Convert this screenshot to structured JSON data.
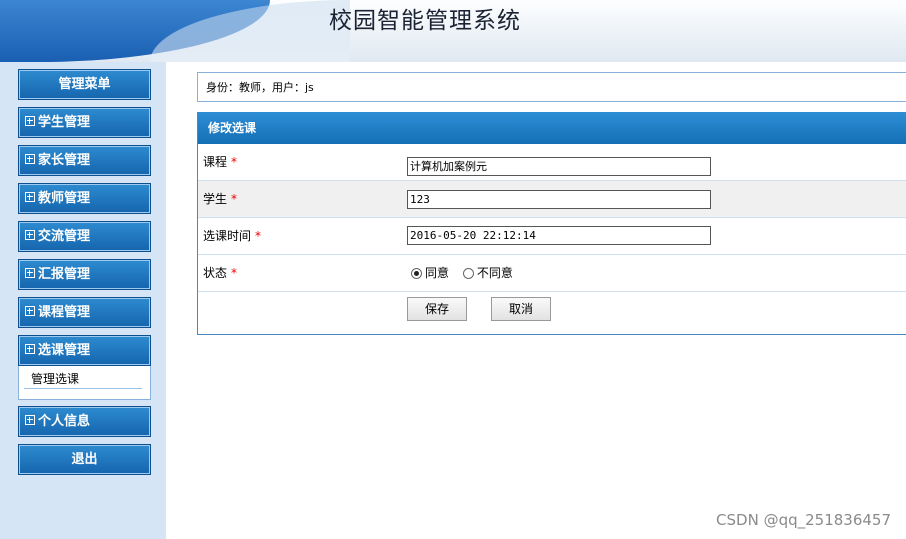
{
  "header": {
    "title": "校园智能管理系统"
  },
  "sidebar": {
    "menu_title": "管理菜单",
    "items": [
      {
        "label": "学生管理"
      },
      {
        "label": "家长管理"
      },
      {
        "label": "教师管理"
      },
      {
        "label": "交流管理"
      },
      {
        "label": "汇报管理"
      },
      {
        "label": "课程管理"
      },
      {
        "label": "选课管理",
        "expanded": true,
        "children": [
          {
            "label": "管理选课"
          }
        ]
      },
      {
        "label": "个人信息"
      }
    ],
    "logout_label": "退出"
  },
  "identity": {
    "text": "身份：教师，用户：js"
  },
  "form": {
    "title": "修改选课",
    "required_mark": "*",
    "fields": {
      "course": {
        "label": "课程",
        "value": "计算机加案例元"
      },
      "student": {
        "label": "学生",
        "value": "123"
      },
      "time": {
        "label": "选课时间",
        "value": "2016-05-20 22:12:14"
      },
      "status": {
        "label": "状态",
        "options": [
          "同意",
          "不同意"
        ],
        "selected": "同意"
      }
    },
    "save_label": "保存",
    "cancel_label": "取消"
  },
  "watermark": "CSDN @qq_251836457",
  "colors": {
    "sidebar_button": "#1a73bc",
    "header_bar": "#1a73bc",
    "required": "#e00000"
  }
}
